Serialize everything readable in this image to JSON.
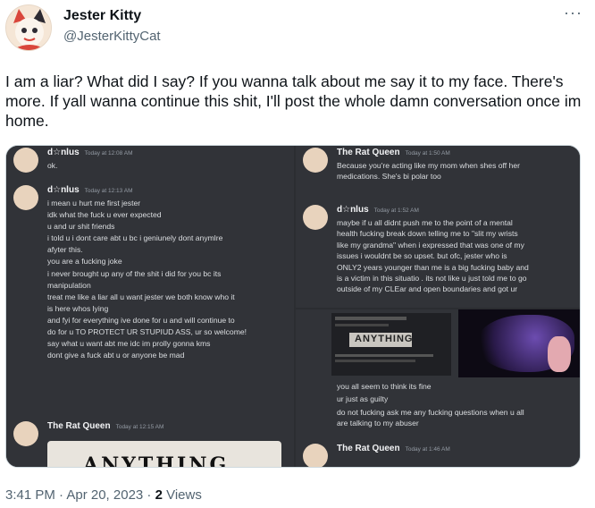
{
  "user": {
    "display_name": "Jester Kitty",
    "handle": "@JesterKittyCat"
  },
  "tweet": {
    "text": "I am a liar? What did I say? If you wanna talk about me say it to my face. There's more. If yall wanna continue this shit, I'll post the whole damn conversation once im home."
  },
  "media": {
    "left": {
      "msg1": {
        "author": "d☆nlus",
        "time": "Today at 12:08 AM",
        "lines": [
          "ok."
        ]
      },
      "msg2": {
        "author": "d☆nlus",
        "time": "Today at 12:13 AM",
        "lines": [
          "i mean u hurt me first jester",
          "idk what the fuck u ever expected",
          "u and ur shit friends",
          "i told u i dont care abt u bc i geniunely dont anymlre",
          "afyter this.",
          "you are a fucking joke",
          "i never brought up any of the shit i did for you bc its",
          "manipulation",
          "treat me like a liar all u want jester we both know who it",
          "is here whos lying",
          "and fyi for everything ive done for u and will continue to",
          "do for u TO PROTECT UR STUPIUD ASS, ur so welcome!",
          "say what u want abt me idc im prolly gonna kms",
          "dont give a fuck abt u or anyone be mad"
        ]
      },
      "msg3": {
        "author": "The Rat Queen",
        "time": "Today at 12:15 AM"
      },
      "embed_text": "ANYTHING"
    },
    "right_top": {
      "msg1": {
        "author": "The Rat Queen",
        "time": "Today at 1:50 AM",
        "lines": [
          "Because you're acting like my mom when shes off her",
          "medications. She's bi polar too"
        ]
      },
      "msg2": {
        "author": "d☆nlus",
        "time": "Today at 1:52 AM",
        "lines": [
          "maybe if u all didnt push me to the point of a mental",
          "health fucking break down telling me to \"slit my wrists",
          "like my grandma\" when i expressed that was one of my",
          "issues i wouldnt be so upset. but ofc, jester who is",
          "ONLY2 years younger than me is a big fucking baby and",
          "is a victim in this situatio . its not like u just told me to go",
          "outside of my CLEar and open boundaries and got ur"
        ]
      }
    },
    "right_bottom": {
      "embed_text": "ANYTHING",
      "lines": [
        "you all seem to think its fine",
        "ur just as guilty",
        "do not fucking ask me any fucking questions when u all",
        "are talking to my abuser"
      ],
      "msg": {
        "author": "The Rat Queen",
        "time": "Today at 1:46 AM"
      }
    }
  },
  "footer": {
    "timestamp": "3:41 PM · Apr 20, 2023 · ",
    "views_count": "2",
    "views_label": " Views"
  },
  "colors": {
    "text_primary": "#0f1419",
    "text_secondary": "#536471",
    "discord_bg": "#313338"
  }
}
